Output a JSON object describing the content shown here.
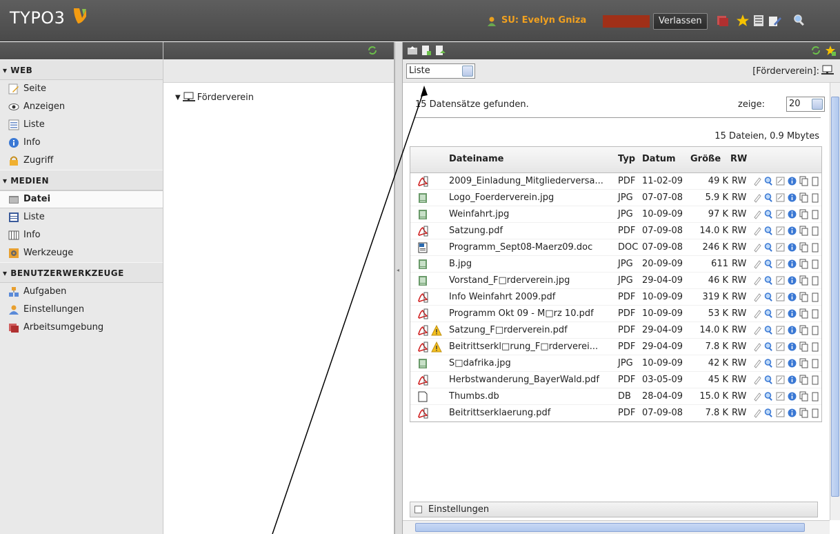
{
  "header": {
    "logo": "TYPO3",
    "user_label": "SU:  Evelyn Gniza",
    "leave_button": "Verlassen"
  },
  "colors": {
    "accent": "#f0a020",
    "topbar": "#4f4f4f",
    "sidebar": "#e9e9e9"
  },
  "sidebar": {
    "sections": [
      {
        "title": "▾ WEB",
        "items": [
          "Seite",
          "Anzeigen",
          "Liste",
          "Info",
          "Zugriff"
        ]
      },
      {
        "title": "▾ MEDIEN",
        "items": [
          "Datei",
          "Liste",
          "Info",
          "Werkzeuge"
        ]
      },
      {
        "title": "▾ BENUTZERWERKZEUGE",
        "items": [
          "Aufgaben",
          "Einstellungen",
          "Arbeitsumgebung"
        ]
      }
    ],
    "active": "Datei"
  },
  "tree": {
    "root": "Förderverein"
  },
  "main": {
    "view_select": "Liste",
    "path_label": "[Förderverein]:",
    "found_text": "15 Datensätze gefunden.",
    "zeige_label": "zeige:",
    "zeige_value": "20",
    "summary": "15 Dateien, 0.9 Mbytes",
    "columns": [
      "Dateiname",
      "Typ",
      "Datum",
      "Größe",
      "RW"
    ],
    "rows": [
      {
        "name": "2009_Einladung_Mitgliederversa...",
        "typ": "PDF",
        "datum": "11-02-09",
        "size": "49 K",
        "rw": "RW",
        "icon": "pdf-icon",
        "warn": false
      },
      {
        "name": "Logo_Foerderverein.jpg",
        "typ": "JPG",
        "datum": "07-07-08",
        "size": "5.9 K",
        "rw": "RW",
        "icon": "image-icon",
        "warn": false
      },
      {
        "name": "Weinfahrt.jpg",
        "typ": "JPG",
        "datum": "10-09-09",
        "size": "97 K",
        "rw": "RW",
        "icon": "image-icon",
        "warn": false
      },
      {
        "name": "Satzung.pdf",
        "typ": "PDF",
        "datum": "07-09-08",
        "size": "14.0 K",
        "rw": "RW",
        "icon": "pdf-icon",
        "warn": false
      },
      {
        "name": "Programm_Sept08-Maerz09.doc",
        "typ": "DOC",
        "datum": "07-09-08",
        "size": "246 K",
        "rw": "RW",
        "icon": "doc-icon",
        "warn": false
      },
      {
        "name": "B.jpg",
        "typ": "JPG",
        "datum": "20-09-09",
        "size": "611",
        "rw": "RW",
        "icon": "image-icon",
        "warn": false
      },
      {
        "name": "Vorstand_F□rderverein.jpg",
        "typ": "JPG",
        "datum": "29-04-09",
        "size": "46 K",
        "rw": "RW",
        "icon": "image-icon",
        "warn": false
      },
      {
        "name": "Info Weinfahrt 2009.pdf",
        "typ": "PDF",
        "datum": "10-09-09",
        "size": "319 K",
        "rw": "RW",
        "icon": "pdf-icon",
        "warn": false
      },
      {
        "name": "Programm Okt 09 - M□rz 10.pdf",
        "typ": "PDF",
        "datum": "10-09-09",
        "size": "53 K",
        "rw": "RW",
        "icon": "pdf-icon",
        "warn": false
      },
      {
        "name": "Satzung_F□rderverein.pdf",
        "typ": "PDF",
        "datum": "29-04-09",
        "size": "14.0 K",
        "rw": "RW",
        "icon": "pdf-icon",
        "warn": true
      },
      {
        "name": "Beitrittserkl□rung_F□rderverei...",
        "typ": "PDF",
        "datum": "29-04-09",
        "size": "7.8 K",
        "rw": "RW",
        "icon": "pdf-icon",
        "warn": true
      },
      {
        "name": "S□dafrika.jpg",
        "typ": "JPG",
        "datum": "10-09-09",
        "size": "42 K",
        "rw": "RW",
        "icon": "image-icon",
        "warn": false
      },
      {
        "name": "Herbstwanderung_BayerWald.pdf",
        "typ": "PDF",
        "datum": "03-05-09",
        "size": "45 K",
        "rw": "RW",
        "icon": "pdf-icon",
        "warn": false
      },
      {
        "name": "Thumbs.db",
        "typ": "DB",
        "datum": "28-04-09",
        "size": "15.0 K",
        "rw": "RW",
        "icon": "file-icon",
        "warn": false
      },
      {
        "name": "Beitrittserklaerung.pdf",
        "typ": "PDF",
        "datum": "07-09-08",
        "size": "7.8 K",
        "rw": "RW",
        "icon": "pdf-icon",
        "warn": false
      }
    ],
    "settings_label": "Einstellungen"
  }
}
